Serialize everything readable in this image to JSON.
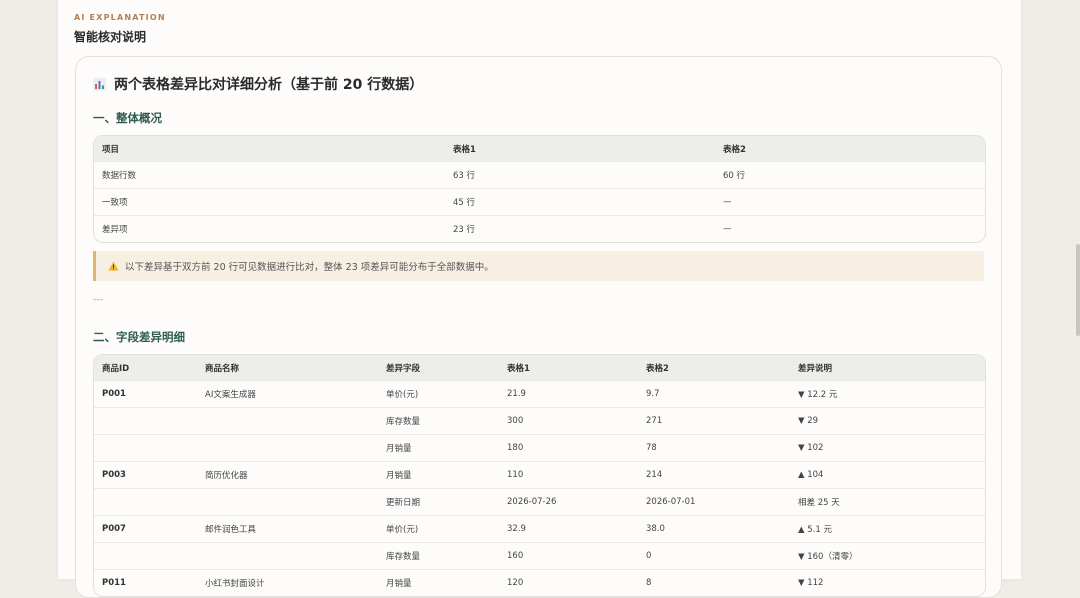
{
  "header": {
    "eyebrow": "AI EXPLANATION",
    "title": "智能核对说明"
  },
  "report": {
    "title": "两个表格差异比对详细分析（基于前 20 行数据）",
    "icon": "bar-chart-icon",
    "overview": {
      "heading": "一、整体概况",
      "columns": [
        "项目",
        "表格1",
        "表格2"
      ],
      "rows": [
        [
          "数据行数",
          "63 行",
          "60 行"
        ],
        [
          "一致项",
          "45 行",
          "—"
        ],
        [
          "差异项",
          "23 行",
          "—"
        ]
      ]
    },
    "note": {
      "icon": "warning-icon",
      "text": "以下差异基于双方前 20 行可见数据进行比对，整体 23 项差异可能分布于全部数据中。"
    },
    "divider": "---",
    "details": {
      "heading": "二、字段差异明细",
      "columns": [
        "商品ID",
        "商品名称",
        "差异字段",
        "表格1",
        "表格2",
        "差异说明"
      ],
      "rows": [
        [
          "P001",
          "AI文案生成器",
          "单价(元)",
          "21.9",
          "9.7",
          "▼ 12.2 元"
        ],
        [
          "",
          "",
          "库存数量",
          "300",
          "271",
          "▼ 29"
        ],
        [
          "",
          "",
          "月销量",
          "180",
          "78",
          "▼ 102"
        ],
        [
          "P003",
          "简历优化器",
          "月销量",
          "110",
          "214",
          "▲ 104"
        ],
        [
          "",
          "",
          "更新日期",
          "2026-07-26",
          "2026-07-01",
          "相差 25 天"
        ],
        [
          "P007",
          "邮件润色工具",
          "单价(元)",
          "32.9",
          "38.0",
          "▲ 5.1 元"
        ],
        [
          "",
          "",
          "库存数量",
          "160",
          "0",
          "▼ 160（清零）"
        ],
        [
          "P011",
          "小红书封面设计",
          "月销量",
          "120",
          "8",
          "▼ 112"
        ]
      ]
    }
  }
}
